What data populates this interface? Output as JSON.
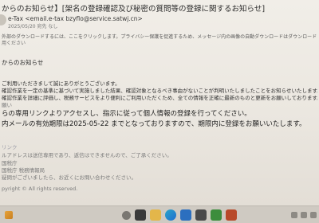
{
  "email": {
    "subject": "からのお知らせ】[架名の登録確認及び秘密の質問等の登録に関するお知らせ]",
    "sender": "e-Tax <email.e-tax bzyflo@service.satwj.cn>",
    "recipient": "2025/05/20 宛先 なし",
    "warning": "外部のダウンロードするには、ここをクリックします。プライバシー保護を促進するため、メッセージ内の画像の自動ダウンロードはダウンロードされません。",
    "warning_sub": "用ください"
  },
  "body_lines": [
    {
      "text": "からのお知らせ",
      "size": "md"
    },
    {
      "text": "",
      "size": "sm"
    },
    {
      "text": "ご利用いただきまして誠にありがとうございます。",
      "size": "sm"
    },
    {
      "text": "確認作業を一定の基準に基づいて実施しました結果、確認対象となるべき事由がないことが判明いたしましたことをお知らせいたします。",
      "size": "sm"
    },
    {
      "text": "確認作業を詳細に評価し、税務サービスをより便利にご利用いただくため、全ての情報を正確に最新のものと更新をお願いしております。",
      "size": "sm"
    },
    {
      "text": "願い",
      "size": "sm"
    },
    {
      "text": "らの専用リンクよりアクセスし、指示に従って個人情報の登録を行ってください。",
      "size": "big"
    },
    {
      "text": "内メールの有効期限は2025-05-22 までとなっておりますので、期限内に登録をお願いいたします。",
      "size": "big"
    },
    {
      "text": "",
      "size": "sm"
    },
    {
      "text": "リンク",
      "size": "sm"
    },
    {
      "text": "ルアドレスは送信専用であり、返信はできませんので、ご了承ください。",
      "size": "sm"
    },
    {
      "text": "国税庁",
      "size": "sm"
    },
    {
      "text": "国税庁 税務情報局",
      "size": "sm"
    },
    {
      "text": "疑問がございましたら、お近くにお問い合わせください。",
      "size": "sm"
    },
    {
      "text": "",
      "size": "sm"
    },
    {
      "text": "pyright ©  All rights reserved.",
      "size": "sm"
    }
  ]
}
